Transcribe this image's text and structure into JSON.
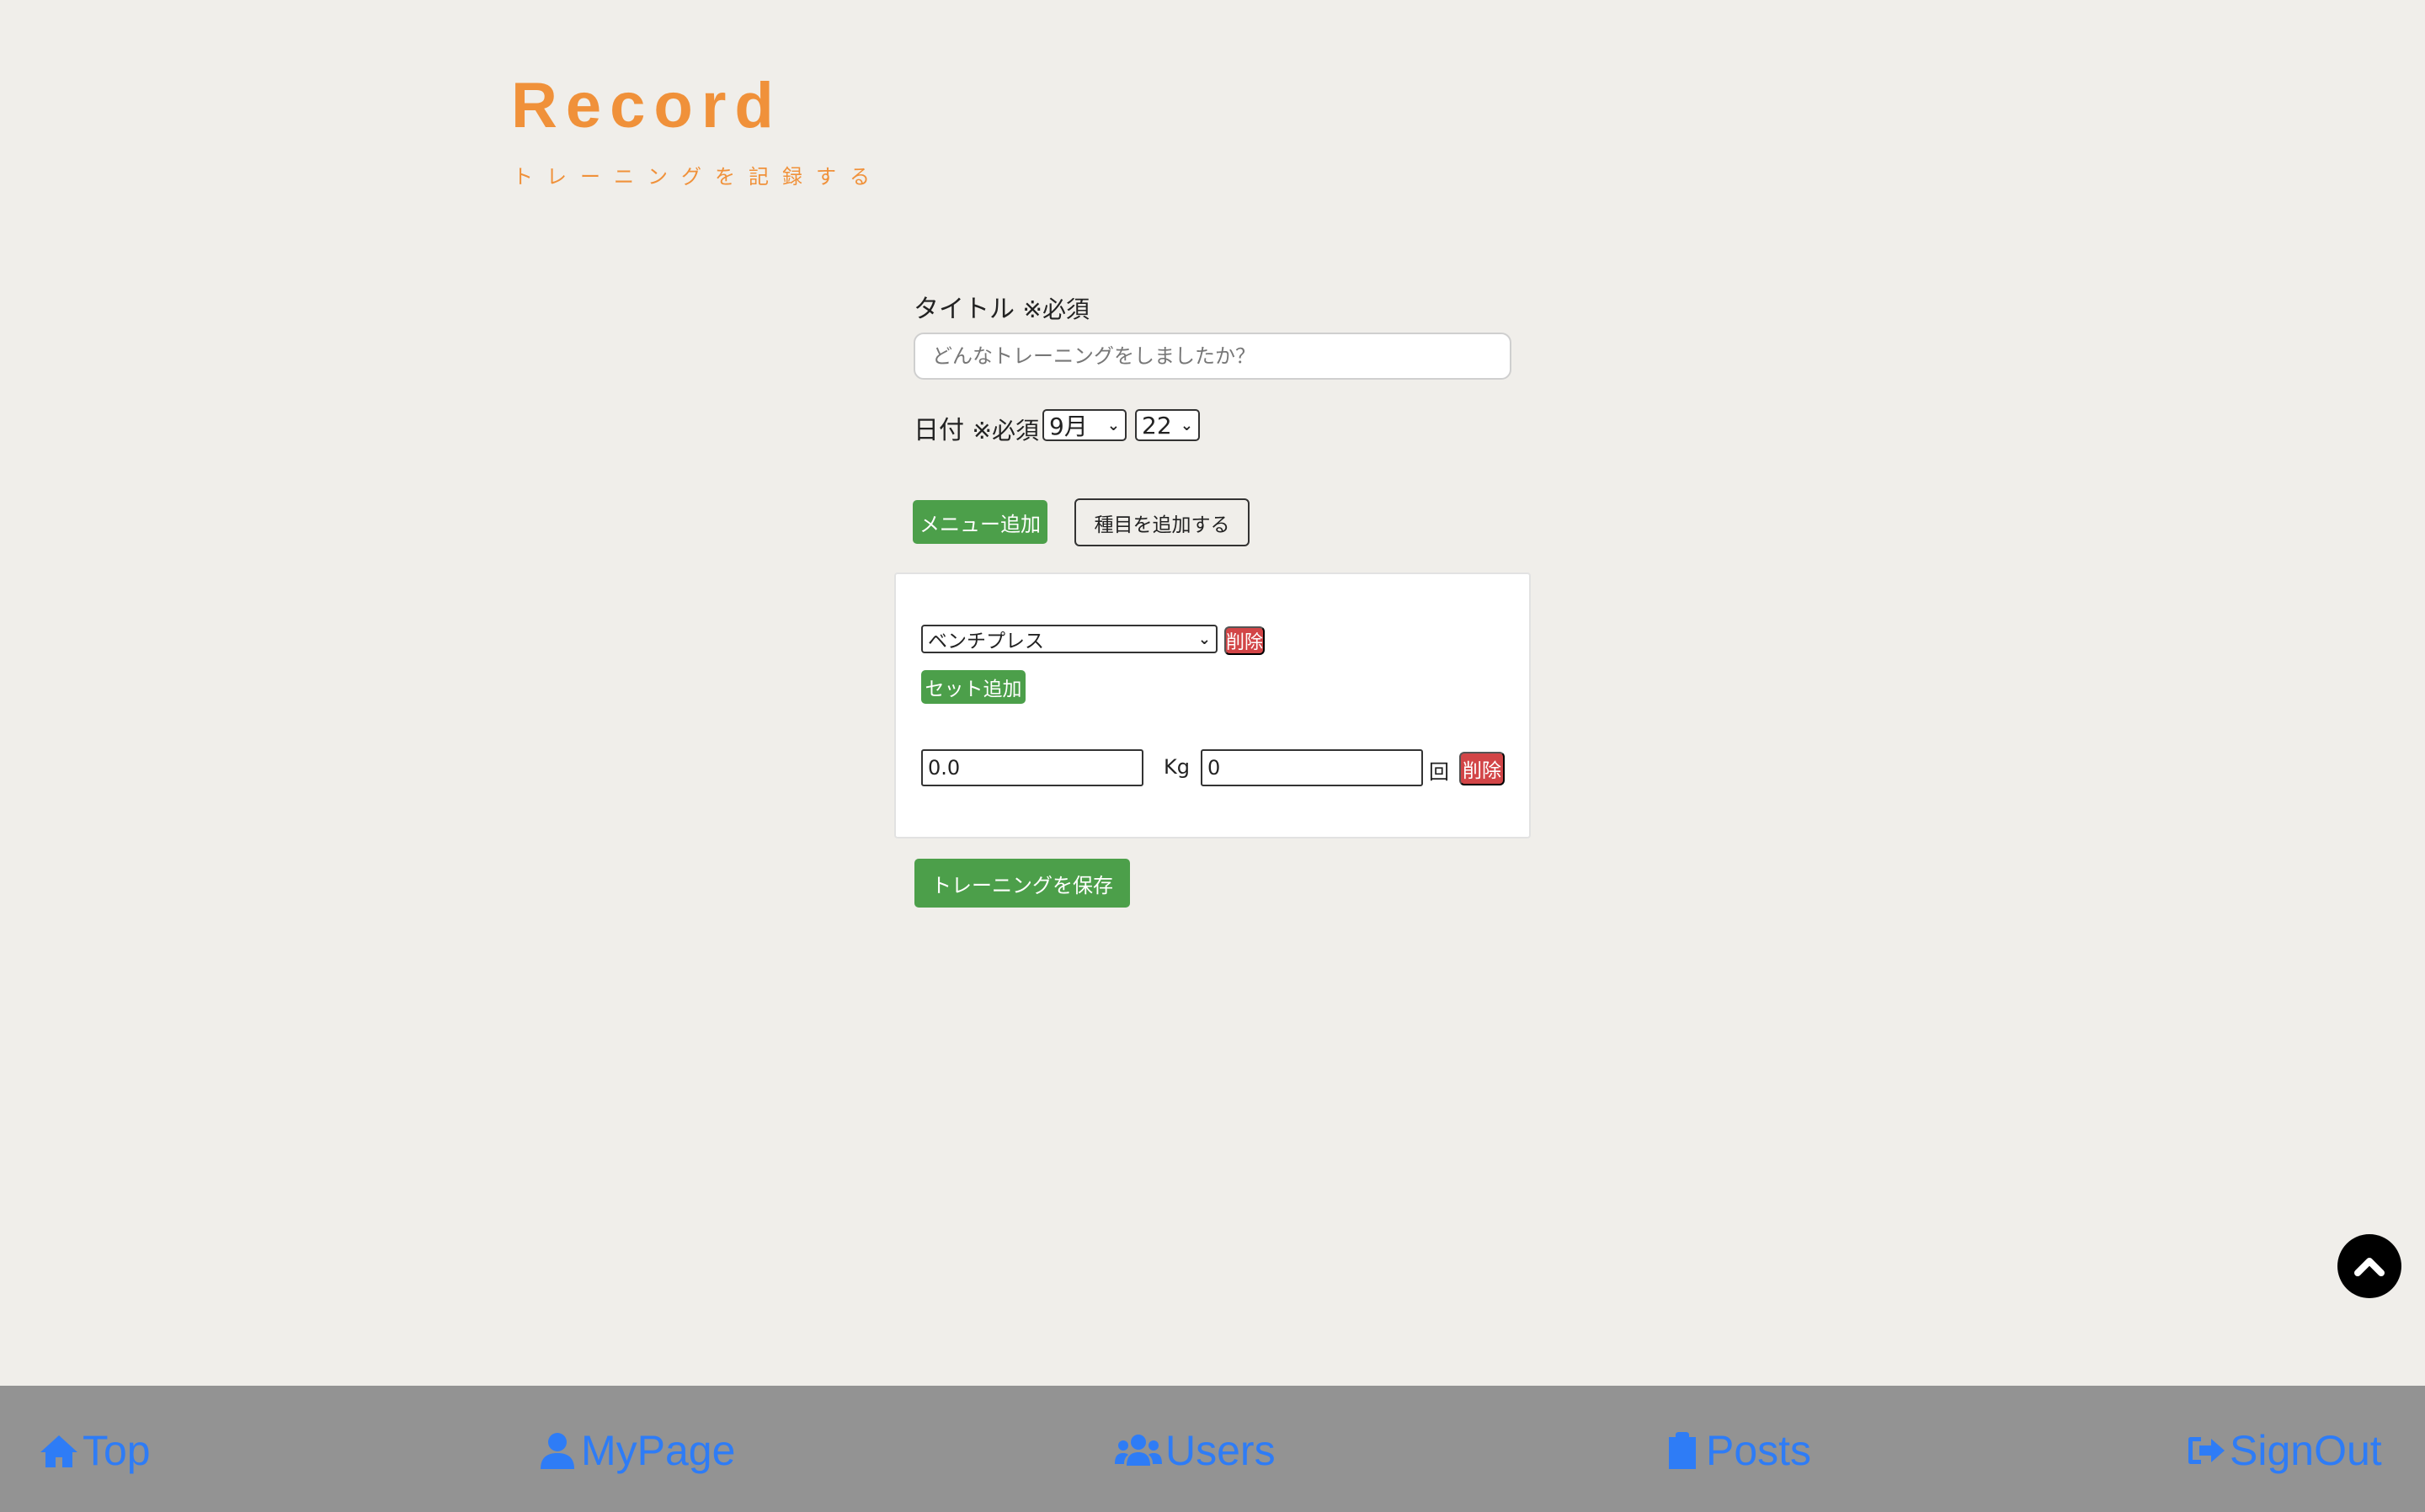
{
  "header": {
    "title": "Record",
    "subtitle": "トレーニングを記録する"
  },
  "form": {
    "title_label": "タイトル",
    "required_mark": "※必須",
    "title_placeholder": "どんなトレーニングをしましたか？",
    "title_value": "",
    "date_label": "日付",
    "month_selected": "9月",
    "day_selected": "22",
    "menu_add_label": "メニュー追加",
    "add_exercise_label": "種目を追加する"
  },
  "exercise_card": {
    "exercise_selected": "ベンチプレス",
    "delete_label": "削除",
    "set_add_label": "セット追加",
    "sets": [
      {
        "weight": "0.0",
        "weight_unit": "Kg",
        "reps": "0",
        "reps_unit": "回",
        "delete_label": "削除"
      }
    ]
  },
  "save_label": "トレーニングを保存",
  "footer_nav": {
    "top": "Top",
    "mypage": "MyPage",
    "users": "Users",
    "posts": "Posts",
    "signout": "SignOut"
  },
  "colors": {
    "accent_orange": "#f0913a",
    "green": "#4c9f4a",
    "red": "#d24547",
    "nav_blue": "#2e7cf6",
    "footer_bg": "#939393",
    "page_bg": "#f0eeea"
  }
}
